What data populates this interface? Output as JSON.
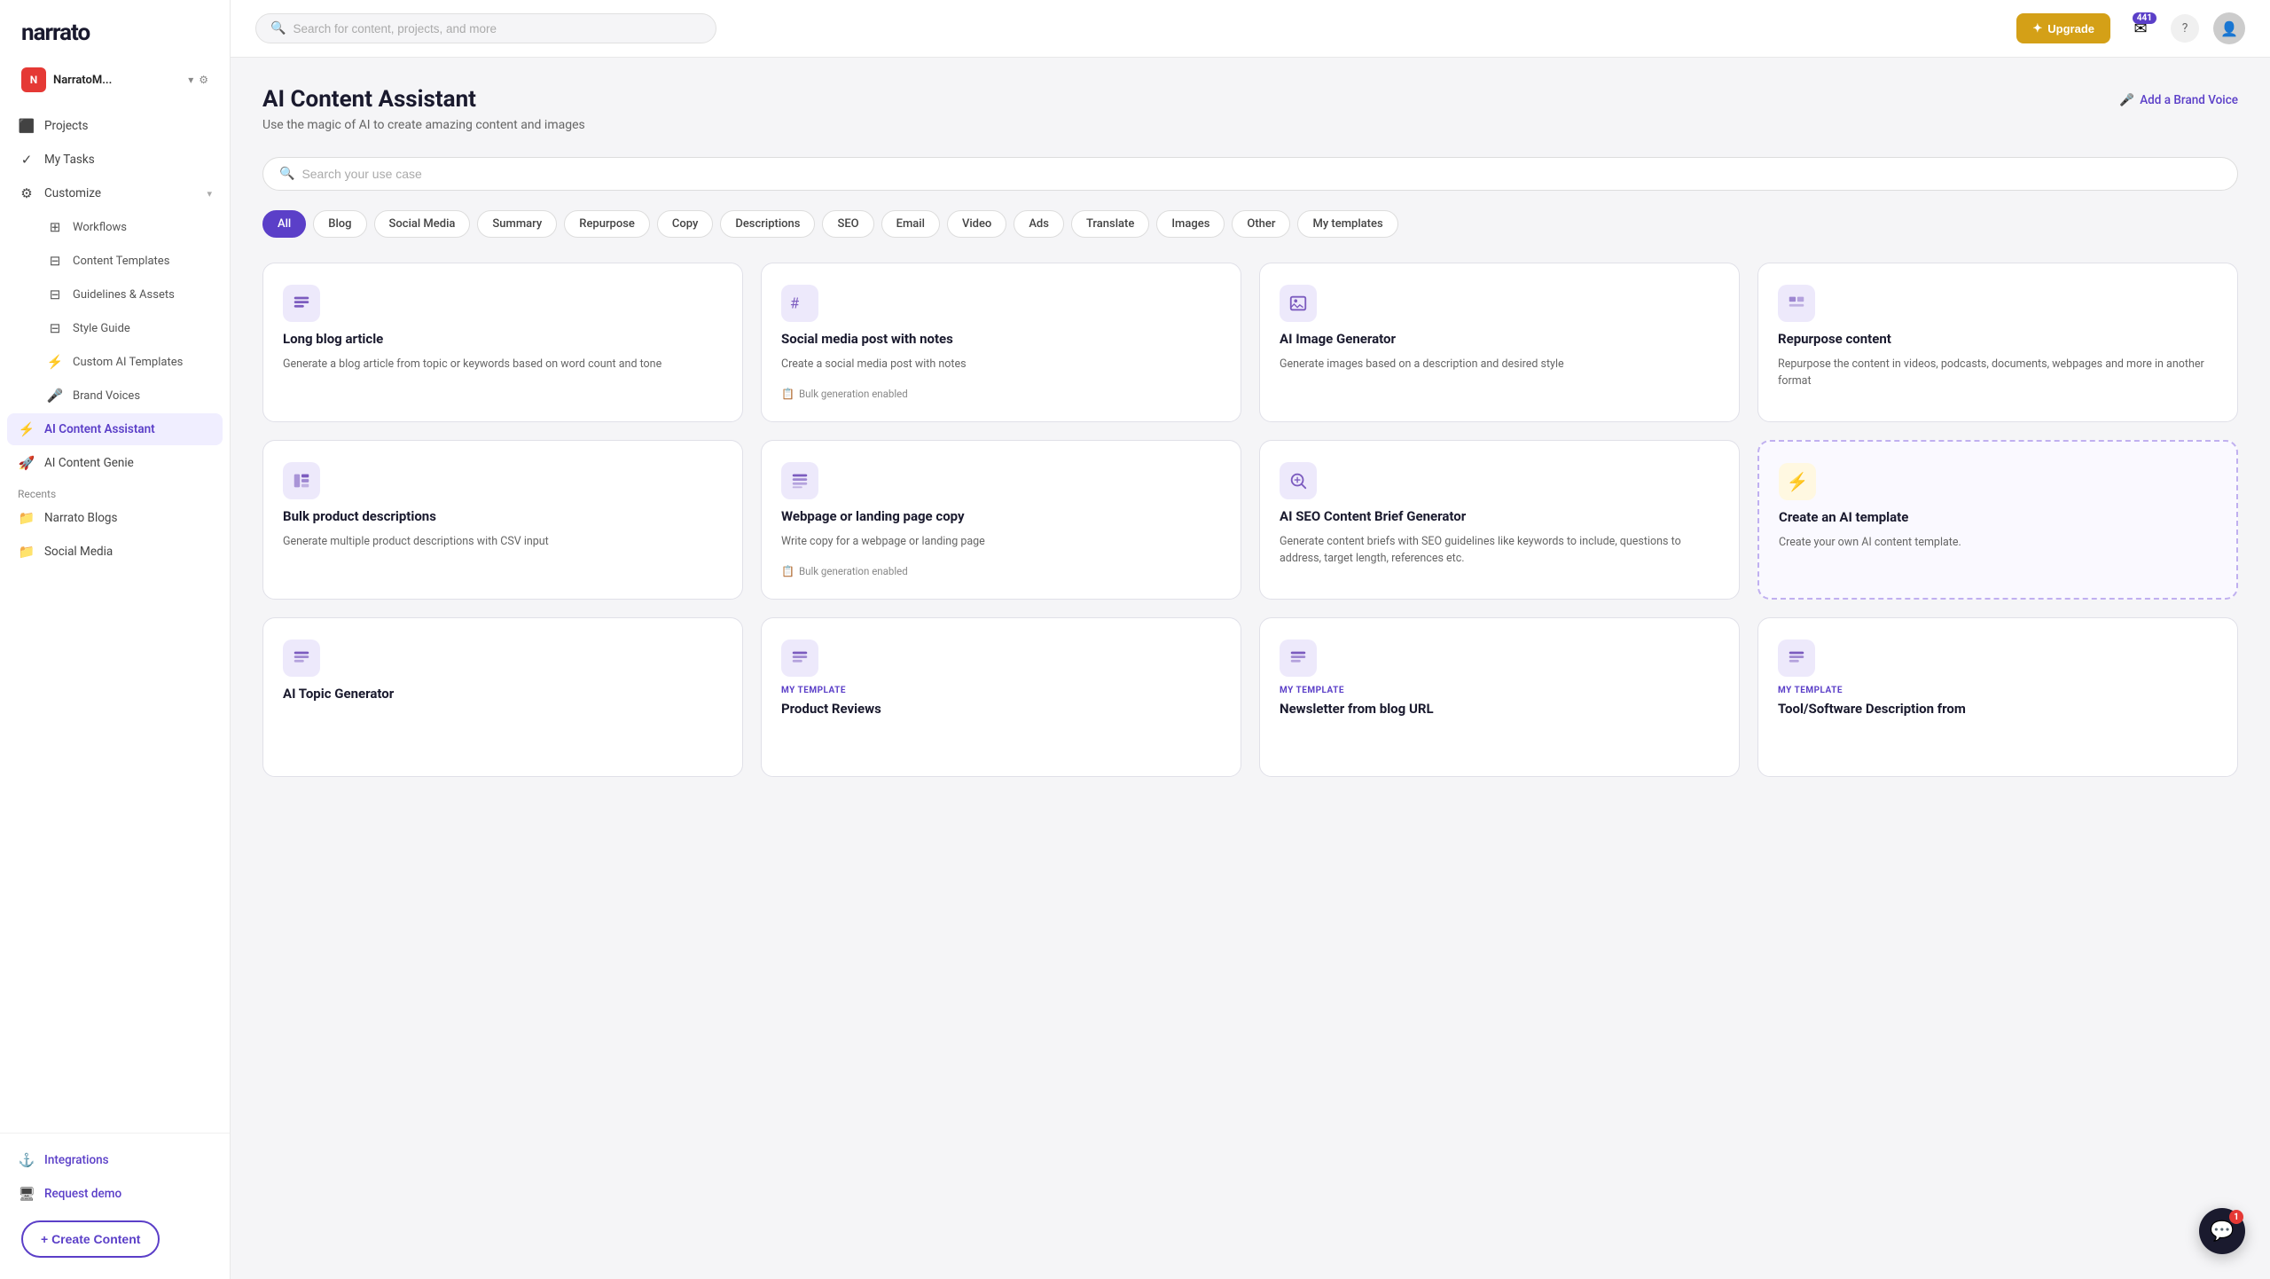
{
  "app": {
    "logo": "narrato",
    "workspace_name": "NarratoM...",
    "workspace_initial": "N"
  },
  "topbar": {
    "search_placeholder": "Search for content, projects, and more",
    "upgrade_label": "Upgrade",
    "notification_badge": "441",
    "chat_badge": "1"
  },
  "sidebar": {
    "nav_items": [
      {
        "id": "projects",
        "label": "Projects",
        "icon": "⬜"
      },
      {
        "id": "my-tasks",
        "label": "My Tasks",
        "icon": "✓"
      },
      {
        "id": "customize",
        "label": "Customize",
        "icon": "⚙",
        "has_dropdown": true
      }
    ],
    "customize_sub": [
      {
        "id": "workflows",
        "label": "Workflows",
        "icon": "⊞"
      },
      {
        "id": "content-templates",
        "label": "Content Templates",
        "icon": "⊟"
      },
      {
        "id": "guidelines-assets",
        "label": "Guidelines & Assets",
        "icon": "⊟"
      },
      {
        "id": "style-guide",
        "label": "Style Guide",
        "icon": "⊟"
      },
      {
        "id": "custom-ai-templates",
        "label": "Custom AI Templates",
        "icon": "⚡"
      },
      {
        "id": "brand-voices",
        "label": "Brand Voices",
        "icon": "🎤"
      }
    ],
    "active_item": {
      "id": "ai-content-assistant",
      "label": "AI Content Assistant",
      "icon": "⚡"
    },
    "bottom_nav": [
      {
        "id": "ai-content-genie",
        "label": "AI Content Genie",
        "icon": "🚀"
      }
    ],
    "recents_label": "Recents",
    "recents": [
      {
        "id": "narrato-blogs",
        "label": "Narrato Blogs"
      },
      {
        "id": "social-media",
        "label": "Social Media"
      }
    ],
    "footer": [
      {
        "id": "integrations",
        "label": "Integrations",
        "icon": "⚓"
      },
      {
        "id": "request-demo",
        "label": "Request demo",
        "icon": "🖥"
      }
    ],
    "create_btn": "+ Create Content"
  },
  "page": {
    "title": "AI Content Assistant",
    "subtitle": "Use the magic of AI to create amazing content and images",
    "brand_voice_btn": "Add a Brand Voice",
    "use_case_placeholder": "Search your use case",
    "filters": [
      {
        "id": "all",
        "label": "All",
        "active": true
      },
      {
        "id": "blog",
        "label": "Blog"
      },
      {
        "id": "social-media",
        "label": "Social Media"
      },
      {
        "id": "summary",
        "label": "Summary"
      },
      {
        "id": "repurpose",
        "label": "Repurpose"
      },
      {
        "id": "copy",
        "label": "Copy"
      },
      {
        "id": "descriptions",
        "label": "Descriptions"
      },
      {
        "id": "seo",
        "label": "SEO"
      },
      {
        "id": "email",
        "label": "Email"
      },
      {
        "id": "video",
        "label": "Video"
      },
      {
        "id": "ads",
        "label": "Ads"
      },
      {
        "id": "translate",
        "label": "Translate"
      },
      {
        "id": "images",
        "label": "Images"
      },
      {
        "id": "other",
        "label": "Other"
      },
      {
        "id": "my-templates",
        "label": "My templates"
      }
    ]
  },
  "cards_row1": [
    {
      "id": "long-blog-article",
      "icon": "≡",
      "icon_style": "default",
      "title": "Long blog article",
      "desc": "Generate a blog article from topic or keywords based on word count and tone",
      "badge": null,
      "dashed": false,
      "my_template": false
    },
    {
      "id": "social-media-post-notes",
      "icon": "#",
      "icon_style": "default",
      "title": "Social media post with notes",
      "desc": "Create a social media post with notes",
      "badge": "Bulk generation enabled",
      "dashed": false,
      "my_template": false
    },
    {
      "id": "ai-image-generator",
      "icon": "🖼",
      "icon_style": "default",
      "title": "AI Image Generator",
      "desc": "Generate images based on a description and desired style",
      "badge": null,
      "dashed": false,
      "my_template": false
    },
    {
      "id": "repurpose-content",
      "icon": "⊟",
      "icon_style": "default",
      "title": "Repurpose content",
      "desc": "Repurpose the content in videos, podcasts, documents, webpages and more in another format",
      "badge": null,
      "dashed": false,
      "my_template": false
    }
  ],
  "cards_row2": [
    {
      "id": "bulk-product-descriptions",
      "icon": "📋",
      "icon_style": "default",
      "title": "Bulk product descriptions",
      "desc": "Generate multiple product descriptions with CSV input",
      "badge": null,
      "dashed": false,
      "my_template": false
    },
    {
      "id": "webpage-landing-page",
      "icon": "≡",
      "icon_style": "default",
      "title": "Webpage or landing page copy",
      "desc": "Write copy for a webpage or landing page",
      "badge": "Bulk generation enabled",
      "dashed": false,
      "my_template": false
    },
    {
      "id": "ai-seo-brief-generator",
      "icon": "🔍",
      "icon_style": "default",
      "title": "AI SEO Content Brief Generator",
      "desc": "Generate content briefs with SEO guidelines like keywords to include, questions to address, target length, references etc.",
      "badge": null,
      "dashed": false,
      "my_template": false
    },
    {
      "id": "create-ai-template",
      "icon": "⚡",
      "icon_style": "yellow",
      "title": "Create an AI template",
      "desc": "Create your own AI content template.",
      "badge": null,
      "dashed": true,
      "my_template": false
    }
  ],
  "cards_row3": [
    {
      "id": "ai-topic-generator",
      "icon": "≡",
      "icon_style": "default",
      "title": "AI Topic Generator",
      "desc": "",
      "badge": null,
      "dashed": false,
      "my_template": false
    },
    {
      "id": "product-reviews",
      "icon": "≡",
      "icon_style": "default",
      "title": "Product Reviews",
      "desc": "",
      "badge": null,
      "dashed": false,
      "my_template": true,
      "my_template_label": "MY TEMPLATE"
    },
    {
      "id": "newsletter-from-blog-url",
      "icon": "≡",
      "icon_style": "default",
      "title": "Newsletter from blog URL",
      "desc": "",
      "badge": null,
      "dashed": false,
      "my_template": true,
      "my_template_label": "MY TEMPLATE"
    },
    {
      "id": "tool-software-description",
      "icon": "≡",
      "icon_style": "default",
      "title": "Tool/Software Description from",
      "desc": "",
      "badge": null,
      "dashed": false,
      "my_template": true,
      "my_template_label": "MY TEMPLATE"
    }
  ]
}
